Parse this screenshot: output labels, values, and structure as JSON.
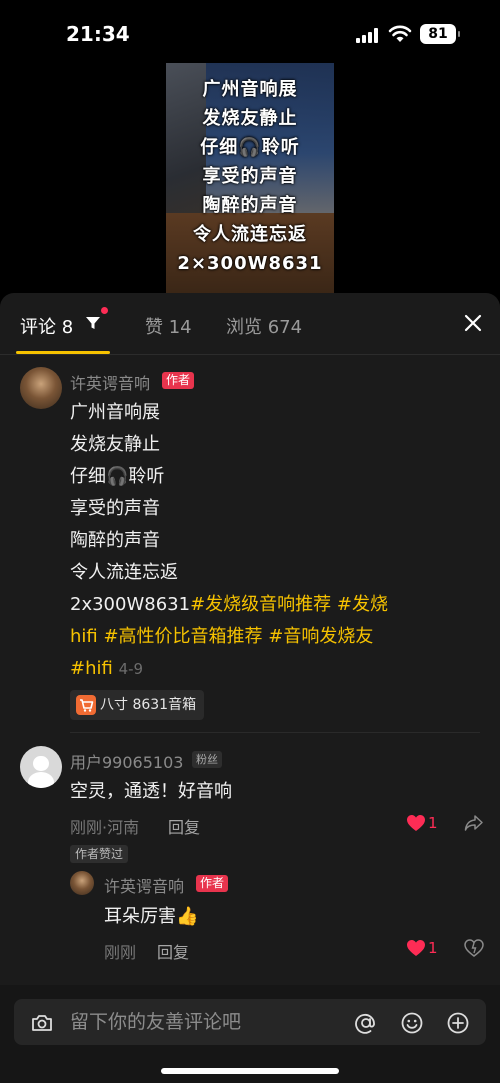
{
  "status": {
    "time": "21:34",
    "battery": "81"
  },
  "video": {
    "lines": [
      "广州音响展",
      "发烧友静止",
      "仔细🎧聆听",
      "享受的声音",
      "陶醉的声音",
      "令人流连忘返",
      "2×300W8631"
    ]
  },
  "tabs": {
    "comments": "评论 8",
    "likes": "赞 14",
    "views": "浏览 674"
  },
  "post": {
    "author": "许英谔音响",
    "author_badge": "作者",
    "lines": [
      "广州音响展",
      "发烧友静止",
      "仔细🎧聆听",
      "享受的声音",
      "陶醉的声音",
      "令人流连忘返"
    ],
    "line7_text": "2x300W8631",
    "line7_tags": "#发烧级音响推荐 #发烧",
    "line8_tags": "hifi #高性价比音箱推荐 #音响发烧友",
    "line9_tag": "#hifi",
    "date": "4-9",
    "product": "八寸 8631音箱"
  },
  "comment1": {
    "user": "用户99065103",
    "badge": "粉丝",
    "text": "空灵，通透！好音响",
    "meta": "刚刚·河南",
    "reply": "回复",
    "likes": "1",
    "liked_by_author": "作者赞过"
  },
  "reply1": {
    "author": "许英谔音响",
    "badge": "作者",
    "text": "耳朵厉害👍",
    "meta": "刚刚",
    "reply": "回复",
    "likes": "1"
  },
  "input": {
    "placeholder": "留下你的友善评论吧"
  },
  "colors": {
    "accent": "#f6c200",
    "like": "#fe2c55",
    "author_badge": "#e8344d"
  }
}
